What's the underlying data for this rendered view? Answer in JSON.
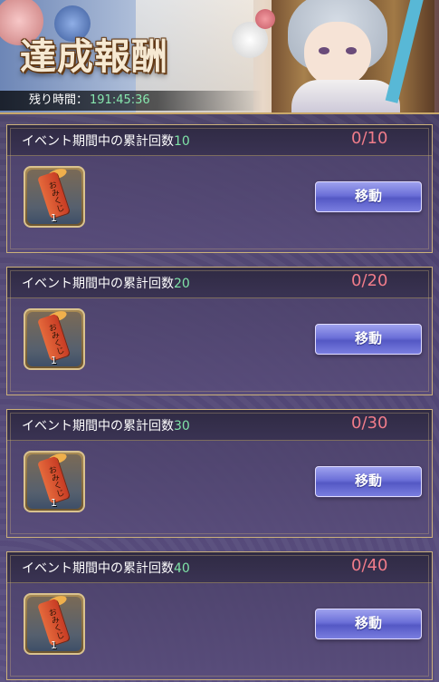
{
  "header": {
    "title": "達成報酬",
    "timer_label": "残り時間：",
    "timer_value": "191:45:36"
  },
  "missions": [
    {
      "label": "イベント期間中の累計回数",
      "target": "10",
      "progress": "0/10",
      "item_text": "おみくじ",
      "item_qty": "1",
      "button": "移動"
    },
    {
      "label": "イベント期間中の累計回数",
      "target": "20",
      "progress": "0/20",
      "item_text": "おみくじ",
      "item_qty": "1",
      "button": "移動"
    },
    {
      "label": "イベント期間中の累計回数",
      "target": "30",
      "progress": "0/30",
      "item_text": "おみくじ",
      "item_qty": "1",
      "button": "移動"
    },
    {
      "label": "イベント期間中の累計回数",
      "target": "40",
      "progress": "0/40",
      "item_text": "おみくじ",
      "item_qty": "1",
      "button": "移動"
    }
  ],
  "colors": {
    "progress": "#f07c8a",
    "target_number": "#7fe3a7",
    "timer_value": "#87e7ae",
    "button": "#6b6fd8",
    "border": "#cbb07a"
  }
}
